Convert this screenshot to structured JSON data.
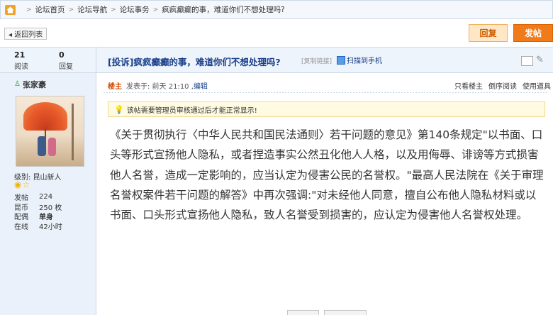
{
  "breadcrumb": {
    "items": [
      "论坛首页",
      "论坛导航",
      "论坛事务",
      "疯疯癫癫的事，难道你们不想处理吗?"
    ],
    "separator": ">"
  },
  "actions": {
    "back_label": "◂ 返回列表",
    "reply_label": "回复",
    "post_label": "发帖"
  },
  "thread": {
    "views_count": "21",
    "views_label": "阅读",
    "replies_count": "0",
    "replies_label": "回复",
    "title": "[投诉]疯疯癫癫的事，难道你们不想处理吗?",
    "copy_link": "[复制链接]",
    "qr_label": "扫描到手机"
  },
  "user": {
    "name": "张家豪",
    "level": "级别: 昆山新人",
    "stars": "◉☆",
    "stats": [
      {
        "key": "发帖",
        "value": "224"
      },
      {
        "key": "昆币",
        "value": "250 枚"
      },
      {
        "key": "配偶",
        "value": "单身"
      },
      {
        "key": "在线",
        "value": "42小时"
      }
    ]
  },
  "post": {
    "author_tag": "楼主",
    "posted": "发表于: 前天 21:10 ,",
    "edit_label": "编辑",
    "tools": [
      "只看楼主",
      "倒序阅读",
      "使用道具"
    ],
    "notice": "该帖需要管理员审核通过后才能正常显示!",
    "content": "《关于贯彻执行〈中华人民共和国民法通则〉若干问题的意见》第140条规定\"以书面、口头等形式宣扬他人隐私，或者捏造事实公然丑化他人人格，以及用侮辱、诽谤等方式损害他人名誉，造成一定影响的，应当认定为侵害公民的名誉权。\"最高人民法院在《关于审理名誉权案件若干问题的解答》中再次强调:\"对未经他人同意，擅自公布他人隐私材料或以书面、口头形式宣扬他人隐私，致人名誉受到损害的，应认定为侵害他人名誉权处理。"
  },
  "colors": {
    "accent": "#f07b1b",
    "link": "#1a3f8a",
    "header_bg": "#eef4fb"
  }
}
